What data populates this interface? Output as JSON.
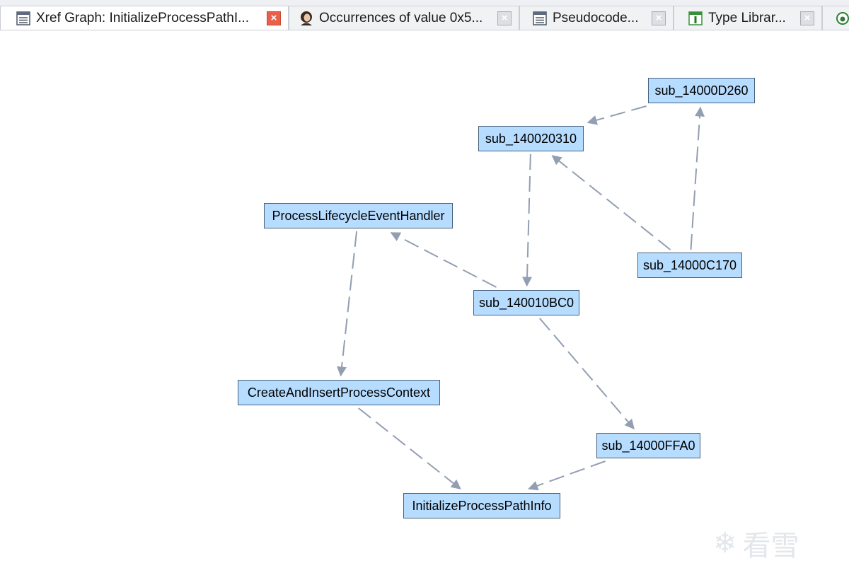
{
  "tabs": [
    {
      "label": "Xref Graph: InitializeProcessPathI...",
      "icon": "listing-icon",
      "active": true
    },
    {
      "label": "Occurrences of value 0x5...",
      "icon": "portrait-icon",
      "active": false
    },
    {
      "label": "Pseudocode...",
      "icon": "listing-icon",
      "active": false
    },
    {
      "label": "Type Librar...",
      "icon": "type-library-icon",
      "active": false
    }
  ],
  "close_glyph": "×",
  "graph": {
    "nodes": {
      "sub_14000D260": "sub_14000D260",
      "sub_140020310": "sub_140020310",
      "ProcessLifecycleEventHandler": "ProcessLifecycleEventHandler",
      "sub_14000C170": "sub_14000C170",
      "sub_140010BC0": "sub_140010BC0",
      "CreateAndInsertProcessContext": "CreateAndInsertProcessContext",
      "sub_14000FFA0": "sub_14000FFA0",
      "InitializeProcessPathInfo": "InitializeProcessPathInfo"
    },
    "edges": [
      [
        "sub_14000D260",
        "sub_140020310"
      ],
      [
        "sub_14000C170",
        "sub_14000D260"
      ],
      [
        "sub_14000C170",
        "sub_140020310"
      ],
      [
        "sub_140020310",
        "sub_140010BC0"
      ],
      [
        "sub_140010BC0",
        "ProcessLifecycleEventHandler"
      ],
      [
        "ProcessLifecycleEventHandler",
        "CreateAndInsertProcessContext"
      ],
      [
        "sub_140010BC0",
        "sub_14000FFA0"
      ],
      [
        "CreateAndInsertProcessContext",
        "InitializeProcessPathInfo"
      ],
      [
        "sub_14000FFA0",
        "InitializeProcessPathInfo"
      ]
    ],
    "node_color": "#b6dcff",
    "edge_color": "#929eb2"
  },
  "watermark": {
    "text": "看雪",
    "icon": "snowflake-icon"
  }
}
